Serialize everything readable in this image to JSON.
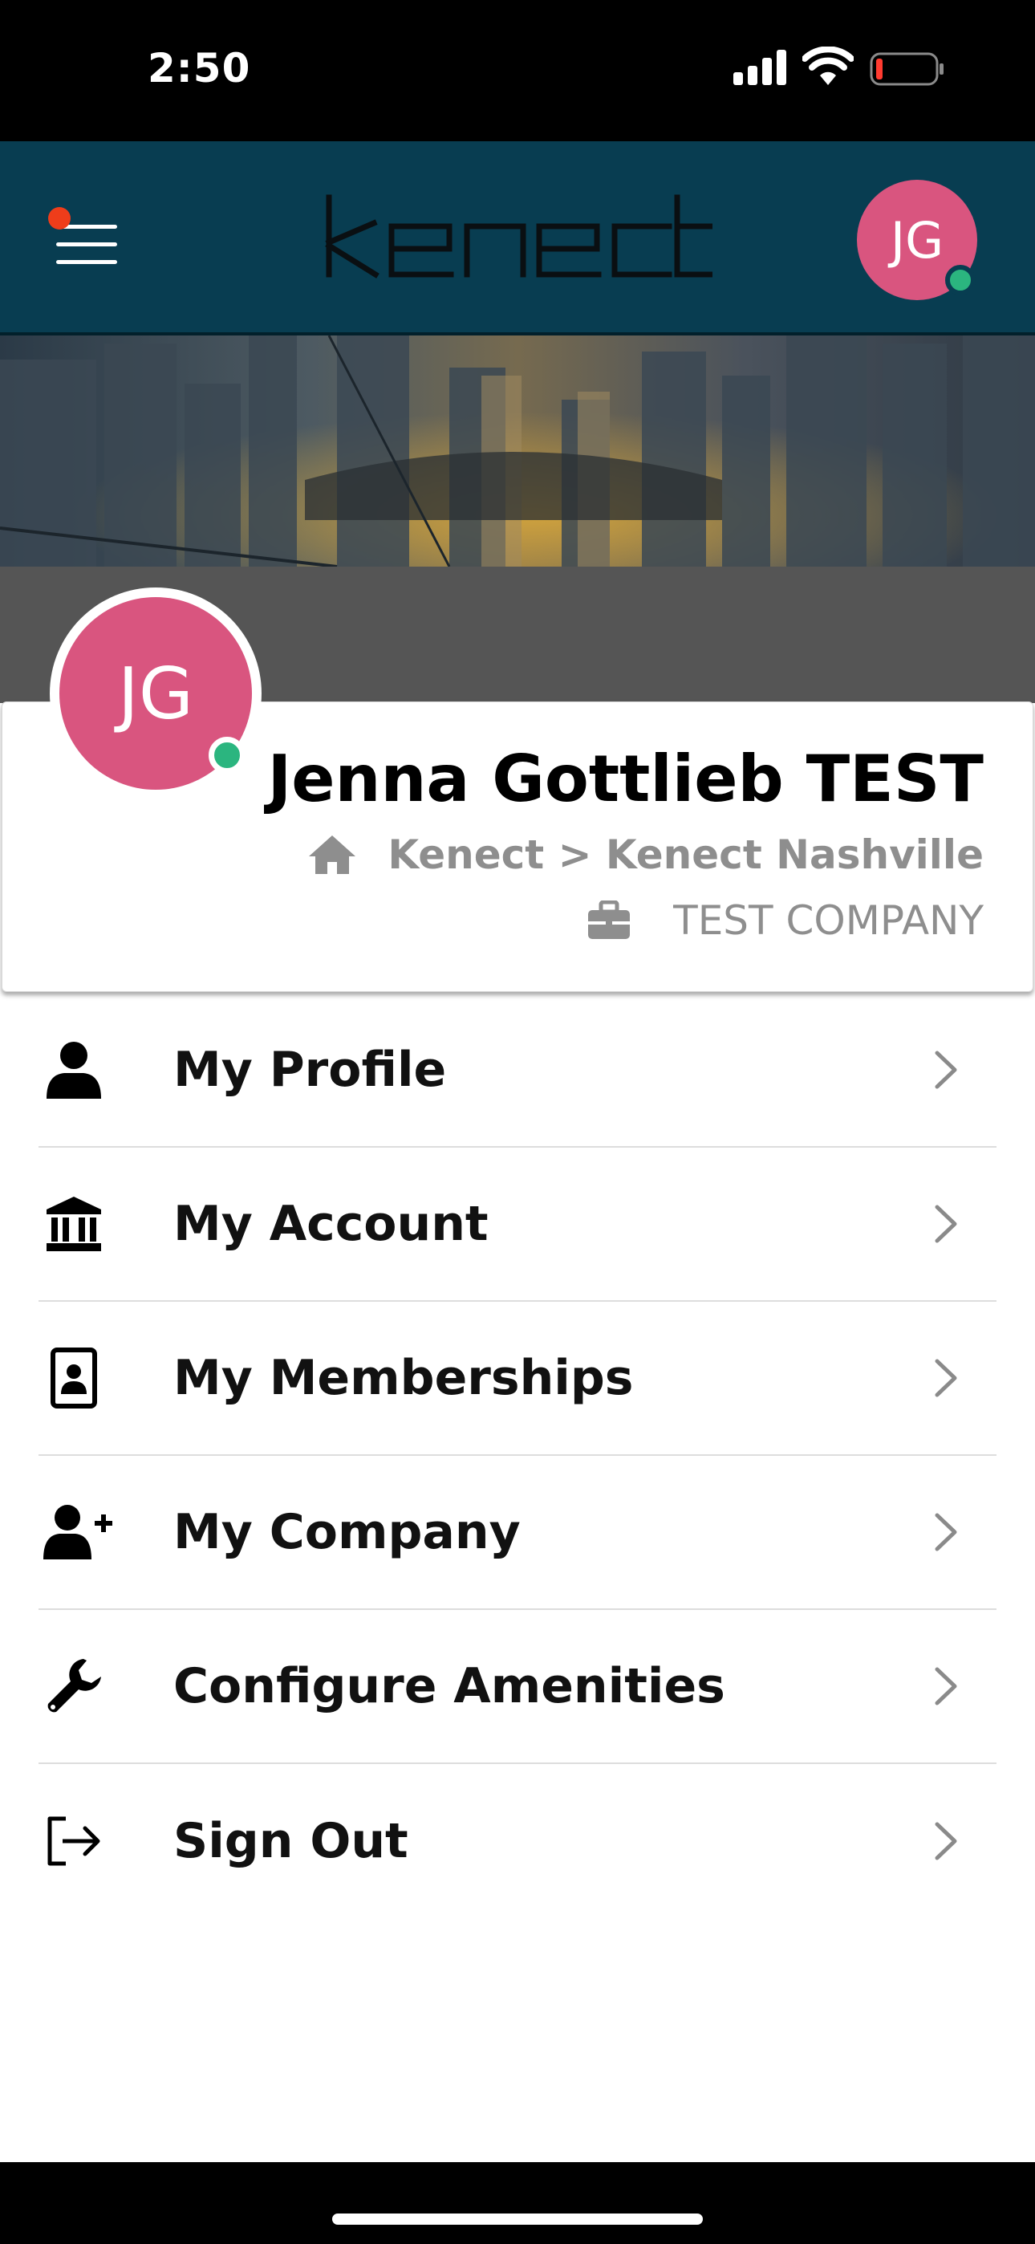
{
  "status_bar": {
    "time": "2:50"
  },
  "header": {
    "logo_text": "kenect",
    "avatar_initials": "JG",
    "notification_dot_color": "#ee3d1a",
    "online_color": "#2bb57f",
    "header_color": "#083d51"
  },
  "profile": {
    "initials": "JG",
    "name": "Jenna Gottlieb TEST",
    "location": "Kenect > Kenect Nashville",
    "company": "TEST COMPANY",
    "avatar_color": "#d9557f"
  },
  "menu": {
    "items": [
      {
        "label": "My Profile",
        "icon": "user-icon"
      },
      {
        "label": "My Account",
        "icon": "bank-icon"
      },
      {
        "label": "My Memberships",
        "icon": "id-badge-icon"
      },
      {
        "label": "My Company",
        "icon": "user-plus-icon"
      },
      {
        "label": "Configure Amenities",
        "icon": "wrench-icon"
      },
      {
        "label": "Sign Out",
        "icon": "sign-out-icon"
      }
    ]
  }
}
